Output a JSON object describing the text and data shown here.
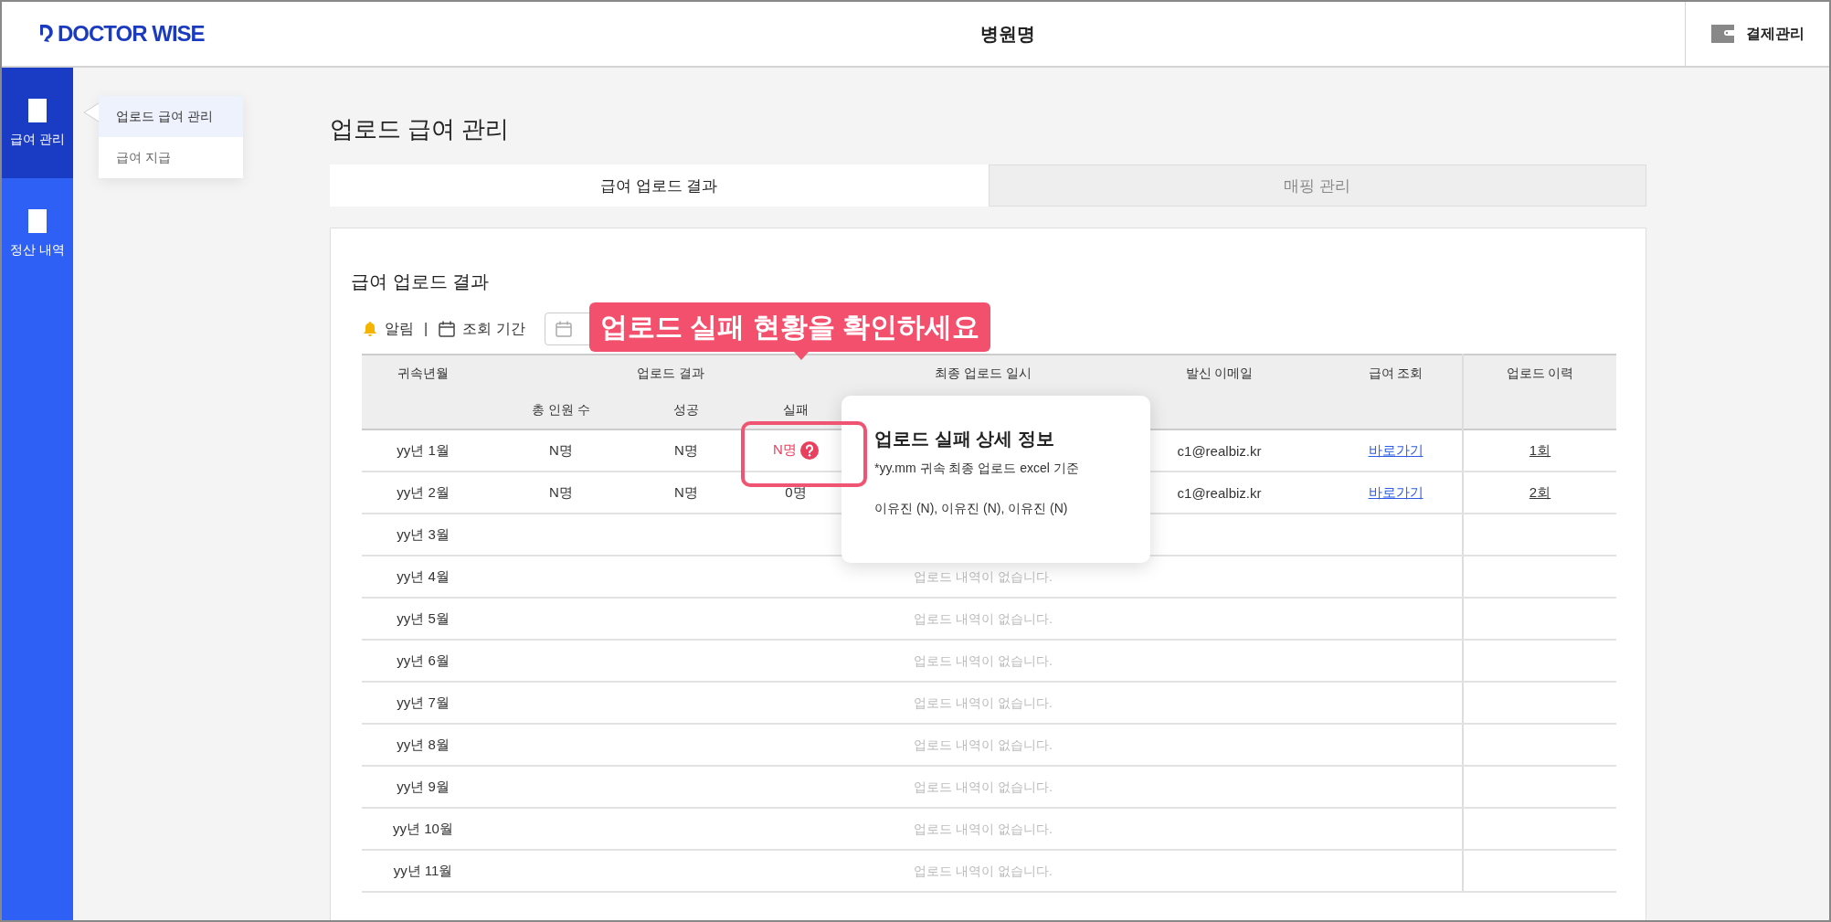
{
  "header": {
    "logo": "DOCTOR WISE",
    "title": "병원명",
    "billing_button": "결제관리"
  },
  "sidebar": {
    "items": [
      {
        "label": "급여 관리",
        "selected": true
      },
      {
        "label": "정산 내역",
        "selected": false
      }
    ]
  },
  "submenu": {
    "items": [
      {
        "label": "업로드 급여 관리",
        "selected": true
      },
      {
        "label": "급여 지급",
        "selected": false
      }
    ]
  },
  "page_title": "업로드 급여 관리",
  "tabs": [
    {
      "label": "급여 업로드 결과",
      "selected": true
    },
    {
      "label": "매핑 관리",
      "selected": false
    }
  ],
  "card": {
    "title": "급여 업로드 결과",
    "alert_label": "알림",
    "separator": "|",
    "period_label": "조회 기간",
    "callout": "업로드 실패 현황을 확인하세요",
    "table": {
      "header_row_1": [
        "귀속년월",
        "업로드 결과",
        "최종 업로드 일시",
        "발신 이메일",
        "급여 조회",
        "업로드 이력"
      ],
      "header_row_2": [
        "총 인원 수",
        "성공",
        "실패"
      ],
      "rows": [
        {
          "month": "yy년 1월",
          "total": "N명",
          "success": "N명",
          "failed": "N명",
          "failed_alert": true,
          "email": "c1@realbiz.kr",
          "view_link": "바로가기",
          "history": "1회"
        },
        {
          "month": "yy년 2월",
          "total": "N명",
          "success": "N명",
          "failed": "0명",
          "failed_alert": false,
          "email": "c1@realbiz.kr",
          "view_link": "바로가기",
          "history": "2회"
        },
        {
          "month": "yy년 3월"
        },
        {
          "month": "yy년 4월",
          "empty_message": "업로드 내역이 없습니다."
        },
        {
          "month": "yy년 5월",
          "empty_message": "업로드 내역이 없습니다."
        },
        {
          "month": "yy년 6월",
          "empty_message": "업로드 내역이 없습니다."
        },
        {
          "month": "yy년 7월",
          "empty_message": "업로드 내역이 없습니다."
        },
        {
          "month": "yy년 8월",
          "empty_message": "업로드 내역이 없습니다."
        },
        {
          "month": "yy년 9월",
          "empty_message": "업로드 내역이 없습니다."
        },
        {
          "month": "yy년 10월",
          "empty_message": "업로드 내역이 없습니다."
        },
        {
          "month": "yy년 11월",
          "empty_message": "업로드 내역이 없습니다."
        }
      ]
    },
    "popup": {
      "title": "업로드 실패 상세 정보",
      "note": "*yy.mm 귀속 최종 업로드 excel 기준",
      "names": "이유진 (N), 이유진 (N), 이유진 (N)"
    }
  }
}
